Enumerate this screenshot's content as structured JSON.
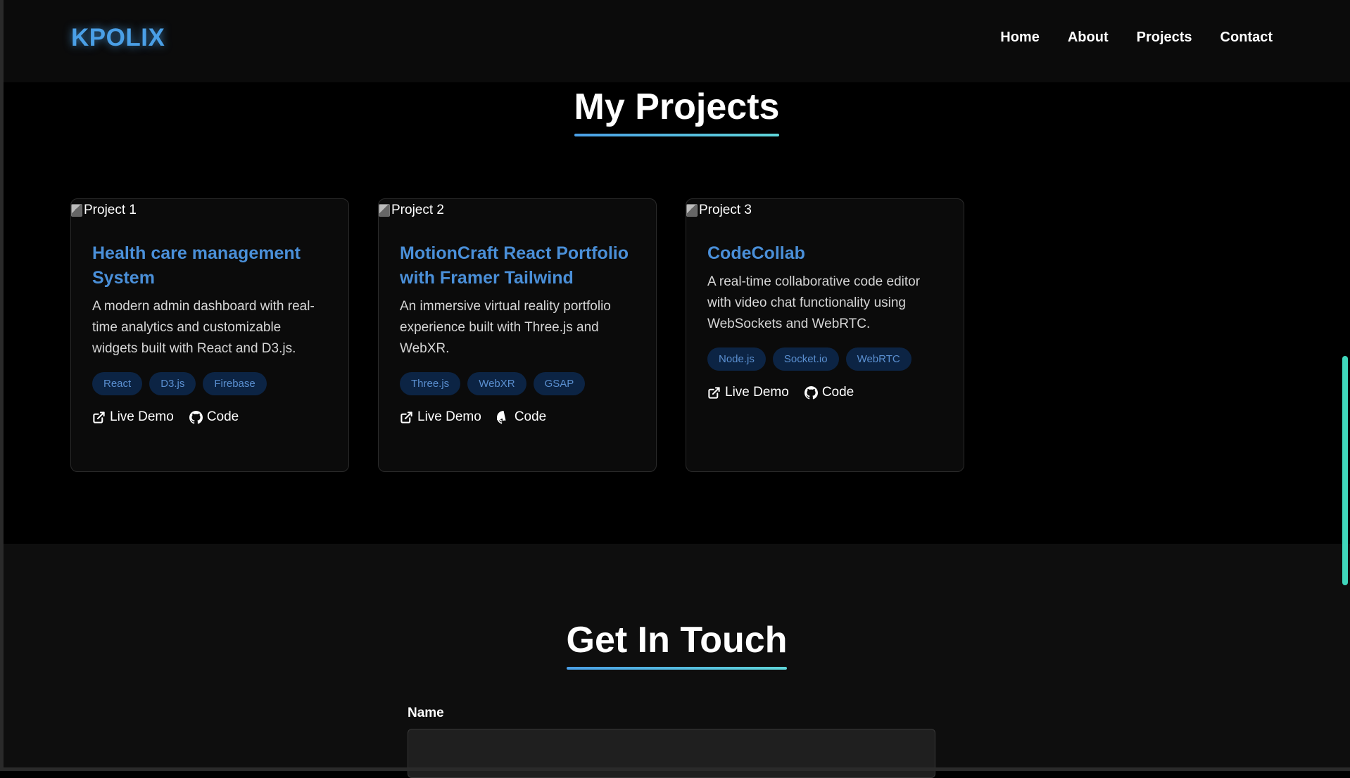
{
  "site": {
    "logo": "KPOLIX",
    "nav": [
      "Home",
      "About",
      "Projects",
      "Contact"
    ]
  },
  "projects": {
    "title": "My Projects",
    "items": [
      {
        "image_alt": "Project 1",
        "title": "Health care management System",
        "description": "A modern admin dashboard with real-time analytics and customizable widgets built with React and D3.js.",
        "tags": [
          "React",
          "D3.js",
          "Firebase"
        ],
        "live_label": "Live Demo",
        "code_label": "Code"
      },
      {
        "image_alt": "Project 2",
        "title": "MotionCraft React Portfolio with Framer Tailwind",
        "description": "An immersive virtual reality portfolio experience built with Three.js and WebXR.",
        "tags": [
          "Three.js",
          "WebXR",
          "GSAP"
        ],
        "live_label": "Live Demo",
        "code_label": "Code"
      },
      {
        "image_alt": "Project 3",
        "title": "CodeCollab",
        "description": "A real-time collaborative code editor with video chat functionality using WebSockets and WebRTC.",
        "tags": [
          "Node.js",
          "Socket.io",
          "WebRTC"
        ],
        "live_label": "Live Demo",
        "code_label": "Code"
      }
    ]
  },
  "contact": {
    "title": "Get In Touch",
    "name_label": "Name",
    "name_value": ""
  },
  "icons": {
    "live_demo": "external-link-icon",
    "code": "github-icon",
    "broken_image": "broken-image-icon"
  },
  "colors": {
    "accent": "#4a9fe6",
    "title_link": "#4a8fd8",
    "tag_bg": "#0c2444",
    "tag_text": "#5a8fd0",
    "scrollbar": "#3fd6bb",
    "background": "#000000"
  }
}
